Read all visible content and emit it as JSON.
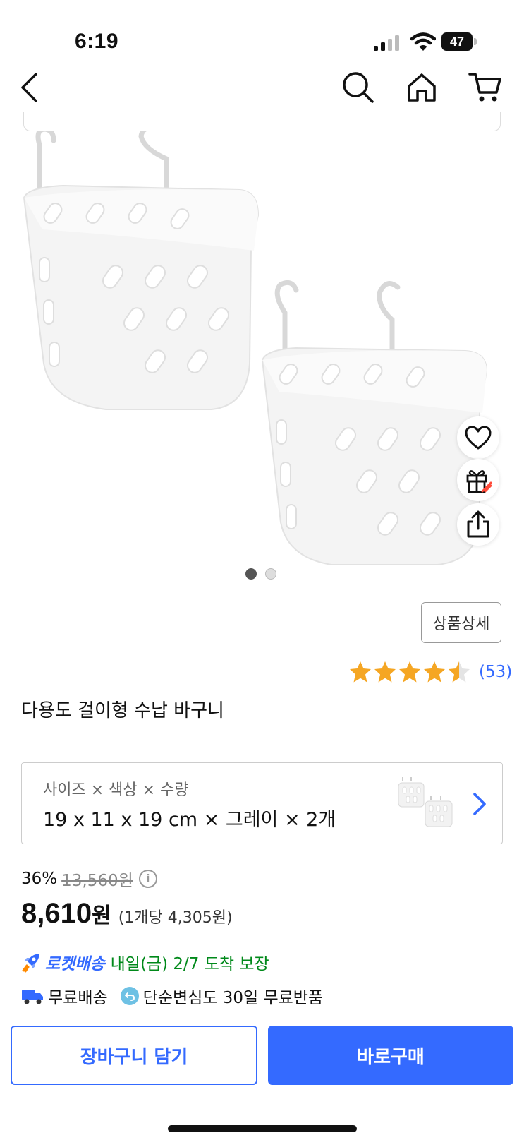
{
  "status_bar": {
    "time": "6:19",
    "battery_level": "47"
  },
  "nav": {
    "icons": [
      "back-icon",
      "search-icon",
      "home-icon",
      "cart-icon"
    ]
  },
  "gallery": {
    "image_count": 2,
    "active_index": 0,
    "side_actions": [
      "heart-icon",
      "gift-icon",
      "share-icon"
    ]
  },
  "detail_button_label": "상품상세",
  "rating": {
    "stars": 4.5,
    "review_count": "(53)",
    "star_color": "#f5a623"
  },
  "product": {
    "title": "다용도 걸이형 수납 바구니"
  },
  "option": {
    "label": "사이즈 × 색상 × 수량",
    "value": "19 x 11 x 19 cm × 그레이 × 2개"
  },
  "price": {
    "discount_rate": "36%",
    "original_price": "13,560원",
    "sale_amount": "8,610",
    "sale_unit": "원",
    "unit_price": "(1개당 4,305원)"
  },
  "delivery": {
    "rocket_label": "로켓배송",
    "arrival_text": "내일(금) 2/7 도착 보장",
    "free_shipping": "무료배송",
    "free_return": "단순변심도 30일 무료반품"
  },
  "actions": {
    "cart_label": "장바구니 담기",
    "buy_label": "바로구매"
  },
  "colors": {
    "accent": "#346aff",
    "arrival_green": "#00891a"
  }
}
